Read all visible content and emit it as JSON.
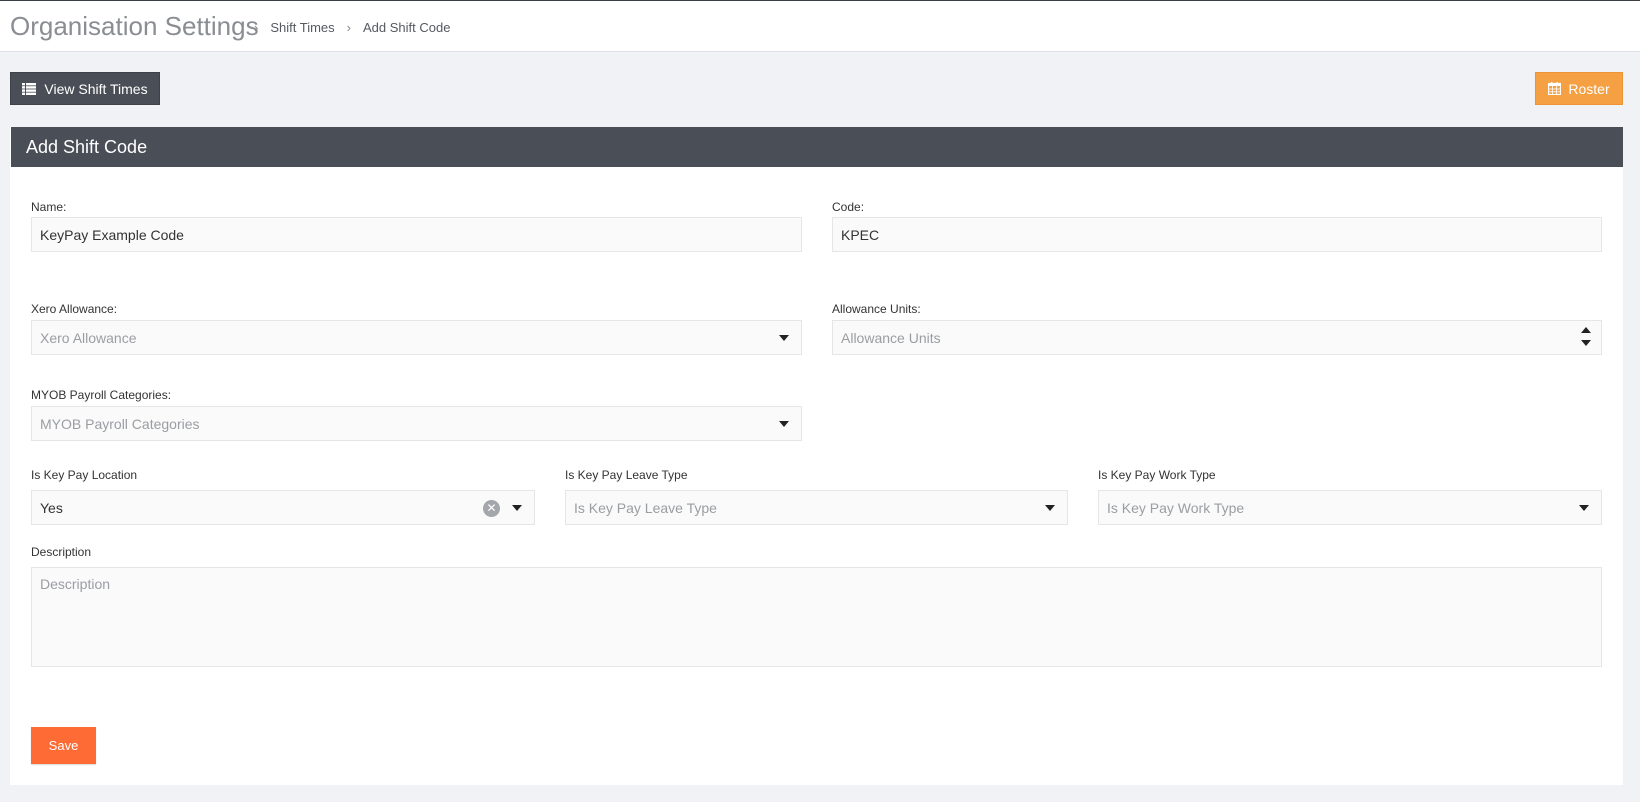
{
  "header": {
    "title": "Organisation Settings",
    "breadcrumb": [
      "Shift Times",
      "Add Shift Code"
    ]
  },
  "toolbar": {
    "view_label": "View Shift Times",
    "roster_label": "Roster"
  },
  "panel": {
    "title": "Add Shift Code"
  },
  "form": {
    "name": {
      "label": "Name:",
      "value": "KeyPay Example Code"
    },
    "code": {
      "label": "Code:",
      "value": "KPEC"
    },
    "xero_allowance": {
      "label": "Xero Allowance:",
      "placeholder": "Xero Allowance"
    },
    "allowance_units": {
      "label": "Allowance Units:",
      "placeholder": "Allowance Units"
    },
    "myob_payroll": {
      "label": "MYOB Payroll Categories:",
      "placeholder": "MYOB Payroll Categories"
    },
    "kp_location": {
      "label": "Is Key Pay Location",
      "value": "Yes"
    },
    "kp_leave_type": {
      "label": "Is Key Pay Leave Type",
      "placeholder": "Is Key Pay Leave Type"
    },
    "kp_work_type": {
      "label": "Is Key Pay Work Type",
      "placeholder": "Is Key Pay Work Type"
    },
    "description": {
      "label": "Description",
      "placeholder": "Description"
    },
    "save_label": "Save"
  },
  "colors": {
    "dark_header": "#4a4f57",
    "roster_accent": "#f5a043",
    "save_accent": "#ff6b35",
    "page_bg": "#f1f2f6"
  },
  "icons": {
    "view_button": "list-icon",
    "roster_button": "calendar-icon",
    "breadcrumb_separator": "chevron-right-icon",
    "select": "caret-down-icon",
    "clear": "clear-icon"
  }
}
